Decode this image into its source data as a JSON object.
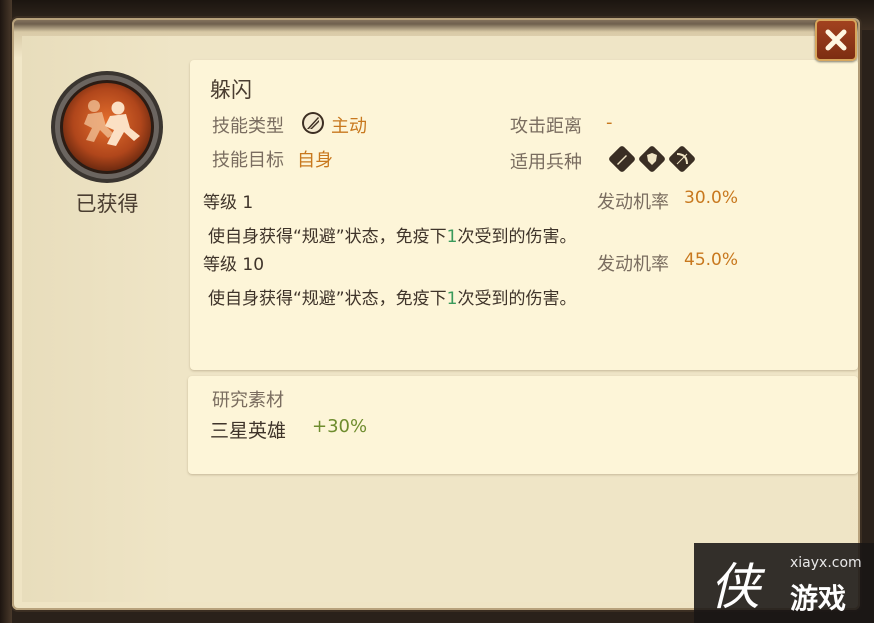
{
  "skill": {
    "name": "躲闪",
    "status": "已获得",
    "type_label": "技能类型",
    "type_value": "主动",
    "target_label": "技能目标",
    "target_value": "自身",
    "range_label": "攻击距离",
    "range_value": "-",
    "unit_label": "适用兵种",
    "unit_icons": [
      "sword-icon",
      "shield-icon",
      "bow-icon"
    ],
    "levels": [
      {
        "level_text": "等级 1",
        "rate_label": "发动机率",
        "rate_value": "30.0%",
        "desc_pre": "使自身获得“规避”状态，免疫下",
        "desc_num": "1",
        "desc_post": "次受到的伤害。"
      },
      {
        "level_text": "等级 10",
        "rate_label": "发动机率",
        "rate_value": "45.0%",
        "desc_pre": "使自身获得“规避”状态，免疫下",
        "desc_num": "1",
        "desc_post": "次受到的伤害。"
      }
    ]
  },
  "research": {
    "title": "研究素材",
    "item": "三星英雄",
    "bonus": "+30%"
  },
  "watermark": {
    "site": "xiayx.com",
    "char": "侠",
    "brand": "游戏"
  },
  "colors": {
    "accent_orange": "#c8781e",
    "accent_green": "#3a9a5b",
    "bonus_green": "#6e8c2e",
    "panel_bg": "#fdf5d8",
    "close_button": "#8a3316"
  }
}
